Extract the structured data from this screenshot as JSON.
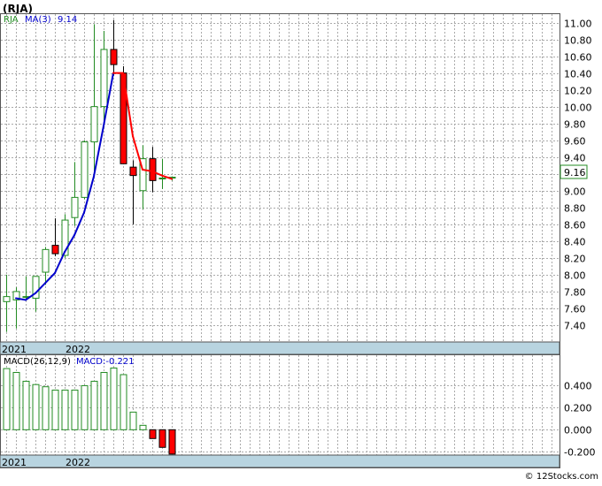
{
  "ticker_title": "(RJA)",
  "watermark": "© 12Stocks.com",
  "colors": {
    "up": "#228b22",
    "down": "#ff0000",
    "ma_up": "#0000cc",
    "ma_down": "#ff0000",
    "macd_bar": "#228b22",
    "macd_neg": "#ff0000",
    "grid": "#aaaaaa",
    "date_band": "#b8d4e0",
    "current_box_bg": "#ffffff"
  },
  "price_panel": {
    "legend_symbol": "RJA",
    "legend_ma": "MA(3)",
    "legend_ma_value": "9.14",
    "current_price_label": "9.16",
    "year_labels": [
      "2021",
      "2022"
    ]
  },
  "macd_panel": {
    "legend_label": "MACD(26,12,9)",
    "legend_value": "MACD:-0.221",
    "year_labels": [
      "2021",
      "2022"
    ]
  },
  "chart_data": [
    {
      "type": "candlestick",
      "title": "(RJA)",
      "y_ticks": [
        "7.40",
        "7.60",
        "7.80",
        "8.00",
        "8.20",
        "8.40",
        "8.60",
        "8.80",
        "9.00",
        "9.20",
        "9.40",
        "9.60",
        "9.80",
        "10.00",
        "10.20",
        "10.40",
        "10.60",
        "10.80",
        "11.00"
      ],
      "ylim": [
        7.2,
        11.1
      ],
      "grid": true,
      "series": [
        {
          "name": "RJA",
          "candles": [
            {
              "open": 7.68,
              "high": 8.0,
              "low": 7.32,
              "close": 7.74
            },
            {
              "open": 7.7,
              "high": 7.85,
              "low": 7.36,
              "close": 7.8
            },
            {
              "open": 7.74,
              "high": 7.98,
              "low": 7.7,
              "close": 7.74
            },
            {
              "open": 7.72,
              "high": 7.93,
              "low": 7.56,
              "close": 7.98
            },
            {
              "open": 8.03,
              "high": 8.33,
              "low": 7.88,
              "close": 8.3
            },
            {
              "open": 8.35,
              "high": 8.67,
              "low": 8.22,
              "close": 8.25
            },
            {
              "open": 8.23,
              "high": 8.72,
              "low": 8.2,
              "close": 8.65
            },
            {
              "open": 8.68,
              "high": 9.34,
              "low": 8.58,
              "close": 8.92
            },
            {
              "open": 8.92,
              "high": 9.6,
              "low": 8.9,
              "close": 9.58
            },
            {
              "open": 9.58,
              "high": 10.98,
              "low": 9.2,
              "close": 10.0
            },
            {
              "open": 10.0,
              "high": 10.9,
              "low": 9.75,
              "close": 10.68
            },
            {
              "open": 10.68,
              "high": 11.03,
              "low": 10.37,
              "close": 10.5
            },
            {
              "open": 10.4,
              "high": 10.48,
              "low": 9.32,
              "close": 9.32
            },
            {
              "open": 9.28,
              "high": 9.36,
              "low": 8.6,
              "close": 9.18
            },
            {
              "open": 9.0,
              "high": 9.54,
              "low": 8.78,
              "close": 9.38
            },
            {
              "open": 9.38,
              "high": 9.52,
              "low": 8.98,
              "close": 9.12
            },
            {
              "open": 9.14,
              "high": 9.38,
              "low": 9.02,
              "close": 9.15
            },
            {
              "open": 9.15,
              "high": 9.17,
              "low": 9.12,
              "close": 9.16
            }
          ]
        },
        {
          "name": "MA(3)",
          "values": [
            null,
            7.72,
            7.7,
            7.78,
            7.9,
            8.02,
            8.27,
            8.47,
            8.74,
            9.17,
            9.77,
            10.4,
            10.4,
            9.65,
            9.25,
            9.23,
            9.18,
            9.14
          ]
        }
      ],
      "x_labels": [
        {
          "index": 0,
          "label": "2021"
        },
        {
          "index": 8,
          "label": "2022"
        }
      ]
    },
    {
      "type": "bar",
      "title": "MACD(26,12,9)",
      "y_ticks": [
        "-0.200",
        "0.000",
        "0.200",
        "0.400"
      ],
      "ylim": [
        -0.23,
        0.58
      ],
      "grid": true,
      "series": [
        {
          "name": "MACD",
          "values": [
            0.555,
            0.52,
            0.44,
            0.41,
            0.39,
            0.36,
            0.36,
            0.36,
            0.4,
            0.44,
            0.52,
            0.56,
            0.5,
            0.16,
            0.04,
            -0.08,
            -0.16,
            -0.221
          ]
        }
      ],
      "x_labels": [
        {
          "index": 0,
          "label": "2021"
        },
        {
          "index": 8,
          "label": "2022"
        }
      ]
    }
  ]
}
